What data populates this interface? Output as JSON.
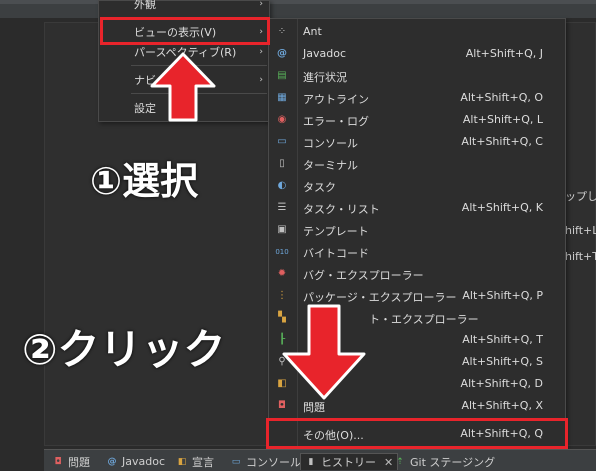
{
  "menu1": {
    "items": [
      {
        "label": "外観",
        "arrow": "›"
      },
      {
        "label": "ビューの表示(V)",
        "arrow": "›"
      },
      {
        "label": "パースペクティブ(R)",
        "arrow": "›"
      },
      {
        "label": "ナビ",
        "arrow": "›"
      },
      {
        "label": "設定"
      }
    ]
  },
  "menu2": {
    "items": [
      {
        "label": "Ant",
        "shortcut": "",
        "icon": "ant-icon"
      },
      {
        "label": "Javadoc",
        "shortcut": "Alt+Shift+Q, J",
        "icon": "javadoc-icon"
      },
      {
        "label": "進行状況",
        "shortcut": "",
        "icon": "progress-icon"
      },
      {
        "label": "アウトライン",
        "shortcut": "Alt+Shift+Q, O",
        "icon": "outline-icon"
      },
      {
        "label": "エラー・ログ",
        "shortcut": "Alt+Shift+Q, L",
        "icon": "error-log-icon"
      },
      {
        "label": "コンソール",
        "shortcut": "Alt+Shift+Q, C",
        "icon": "console-icon"
      },
      {
        "label": "ターミナル",
        "shortcut": "",
        "icon": "terminal-icon"
      },
      {
        "label": "タスク",
        "shortcut": "",
        "icon": "task-icon"
      },
      {
        "label": "タスク・リスト",
        "shortcut": "Alt+Shift+Q, K",
        "icon": "task-list-icon"
      },
      {
        "label": "テンプレート",
        "shortcut": "",
        "icon": "template-icon"
      },
      {
        "label": "バイトコード",
        "shortcut": "",
        "icon": "bytecode-icon"
      },
      {
        "label": "バグ・エクスプローラー",
        "shortcut": "",
        "icon": "bug-explorer-icon"
      },
      {
        "label": "パッケージ・エクスプローラー",
        "shortcut": "Alt+Shift+Q, P",
        "icon": "package-explorer-icon"
      },
      {
        "label": "ト・エクスプローラー",
        "shortcut": "",
        "icon": "project-explorer-icon"
      },
      {
        "label": "",
        "shortcut": "Alt+Shift+Q, T",
        "icon": "hierarchy-icon"
      },
      {
        "label": "",
        "shortcut": "Alt+Shift+Q, S",
        "icon": "search-icon"
      },
      {
        "label": "",
        "shortcut": "Alt+Shift+Q, D",
        "icon": "declaration-icon"
      },
      {
        "label": "問題",
        "shortcut": "Alt+Shift+Q, X",
        "icon": "problems-icon"
      },
      {
        "label": "その他(O)...",
        "shortcut": "Alt+Shift+Q, Q",
        "icon": ""
      }
    ]
  },
  "annotations": {
    "step1": "①選択",
    "step2": "②クリック"
  },
  "right_edge": [
    "ップして",
    "hift+L",
    "hift+T"
  ],
  "tabs": [
    {
      "label": "問題",
      "icon": "problems-icon"
    },
    {
      "label": "Javadoc",
      "icon": "javadoc-icon"
    },
    {
      "label": "宣言",
      "icon": "declaration-icon"
    },
    {
      "label": "コンソール",
      "icon": "console-icon"
    },
    {
      "label": "ヒストリー",
      "icon": "history-icon",
      "close": "✕"
    },
    {
      "label": "Git ステージング",
      "icon": "git-staging-icon"
    }
  ],
  "colors": {
    "highlight": "#e8242b",
    "arrow": "#e8242b"
  }
}
